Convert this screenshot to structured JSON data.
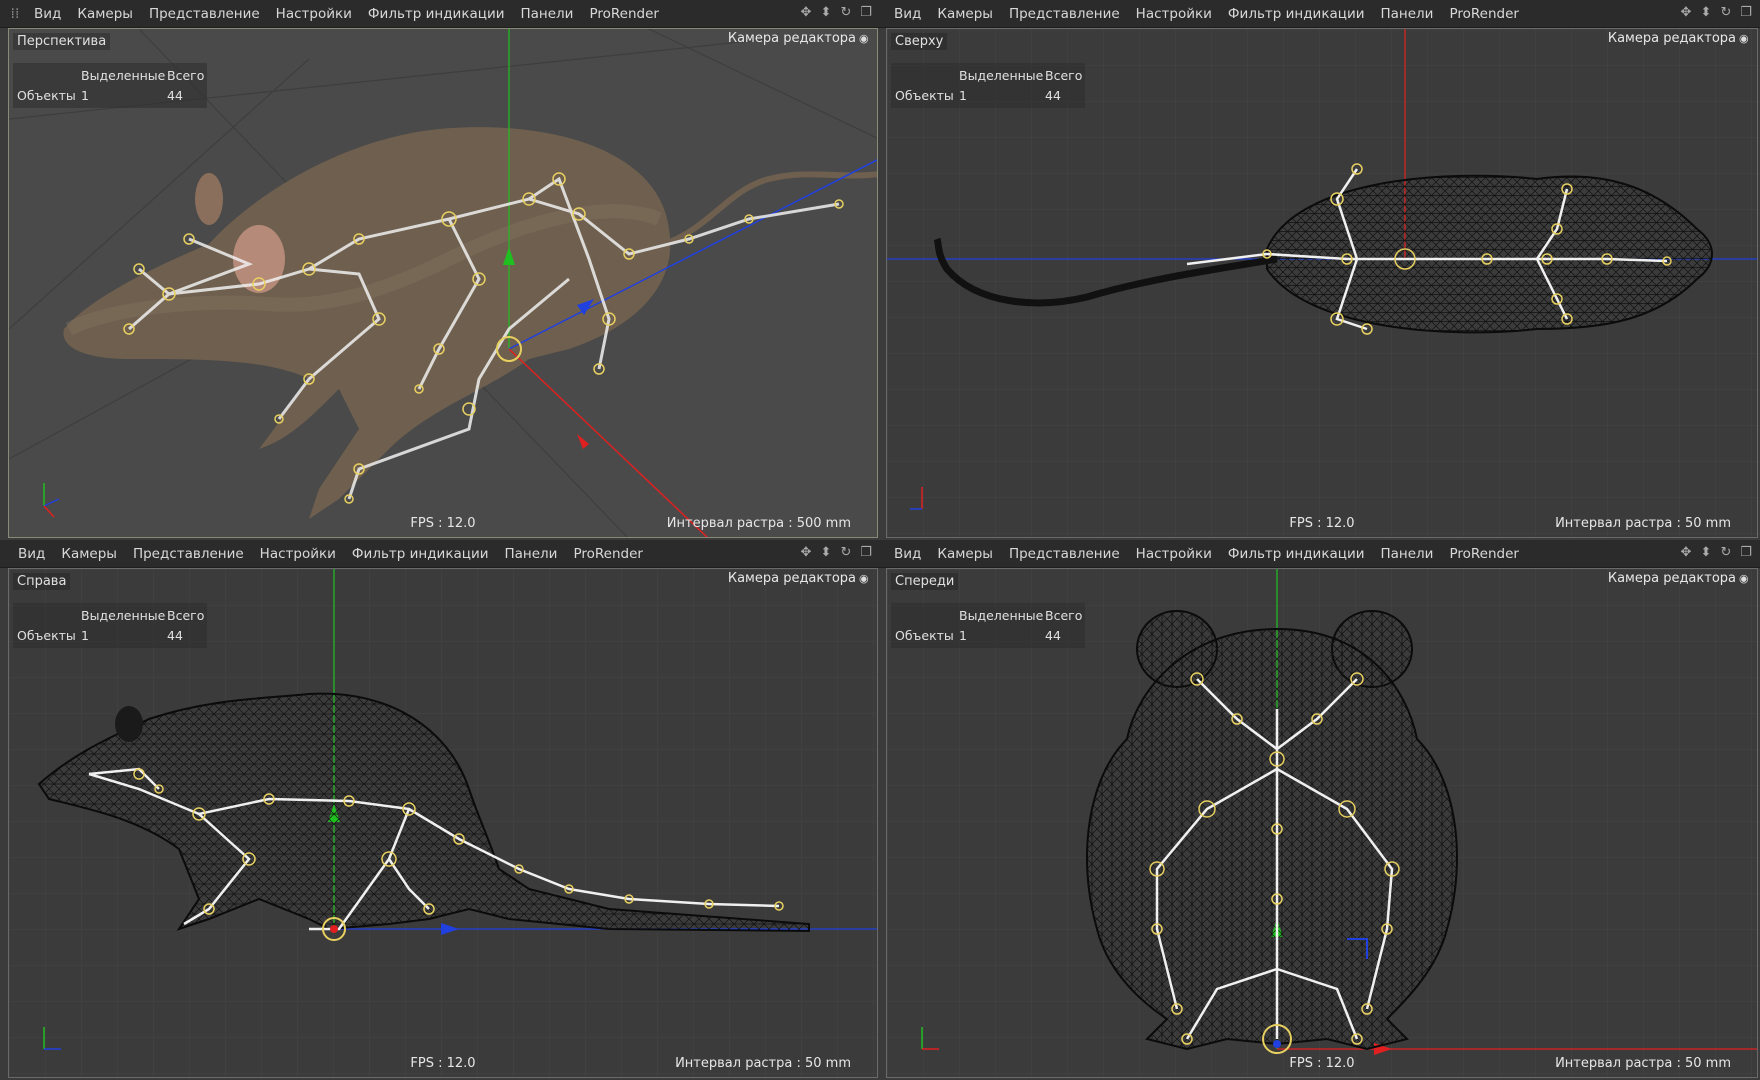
{
  "menu": {
    "items": [
      "Вид",
      "Камеры",
      "Представление",
      "Настройки",
      "Фильтр индикации",
      "Панели",
      "ProRender"
    ]
  },
  "hud": {
    "header_selected": "Выделенные",
    "header_total": "Всего",
    "row_label": "Объекты",
    "selected": "1",
    "total": "44"
  },
  "viewports": {
    "perspective": {
      "name": "Перспектива",
      "camera": "Камера редактора",
      "fps": "FPS : 12.0",
      "grid": "Интервал растра : 500 mm"
    },
    "top": {
      "name": "Сверху",
      "camera": "Камера редактора",
      "fps": "FPS : 12.0",
      "grid": "Интервал растра : 50 mm"
    },
    "right": {
      "name": "Справа",
      "camera": "Камера редактора",
      "fps": "FPS : 12.0",
      "grid": "Интервал растра : 50 mm"
    },
    "front": {
      "name": "Спереди",
      "camera": "Камера редактора",
      "fps": "FPS : 12.0",
      "grid": "Интервал растра : 50 mm"
    }
  },
  "colors": {
    "axis_x": "#e02020",
    "axis_y": "#20c020",
    "axis_z": "#2040e0",
    "joint": "#e8d060",
    "bone": "#f0f0f0",
    "fur": "#7a6a58",
    "wire": "#111111"
  },
  "icons": {
    "grip": "grip-icon",
    "move": "move-icon",
    "zoom": "zoom-icon",
    "rotate": "rotate-icon",
    "maximize": "maximize-icon",
    "camera": "camera-icon"
  }
}
